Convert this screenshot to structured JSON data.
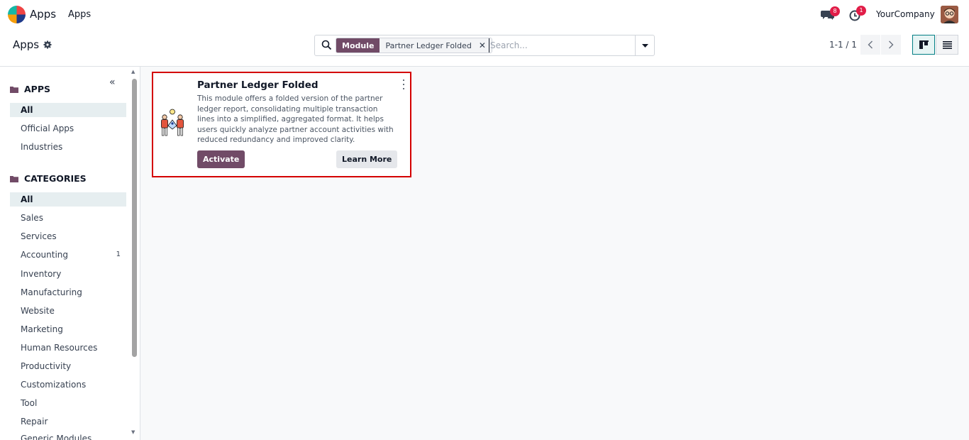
{
  "navbar": {
    "brand": "Apps",
    "menu_item": "Apps",
    "messages_badge": "8",
    "activities_badge": "1",
    "company": "YourCompany"
  },
  "control_panel": {
    "breadcrumb": "Apps",
    "search": {
      "facet_label": "Module",
      "facet_value": "Partner Ledger Folded",
      "placeholder": "Search..."
    },
    "pager": "1-1 / 1"
  },
  "sidebar": {
    "apps_header": "APPS",
    "apps_items": [
      {
        "label": "All",
        "active": true
      },
      {
        "label": "Official Apps"
      },
      {
        "label": "Industries"
      }
    ],
    "categories_header": "CATEGORIES",
    "category_items": [
      {
        "label": "All",
        "active": true
      },
      {
        "label": "Sales"
      },
      {
        "label": "Services"
      },
      {
        "label": "Accounting",
        "count": "1"
      },
      {
        "label": "Inventory"
      },
      {
        "label": "Manufacturing"
      },
      {
        "label": "Website"
      },
      {
        "label": "Marketing"
      },
      {
        "label": "Human Resources"
      },
      {
        "label": "Productivity"
      },
      {
        "label": "Customizations"
      },
      {
        "label": "Tool"
      },
      {
        "label": "Repair"
      },
      {
        "label": "Generic Modules"
      }
    ]
  },
  "card": {
    "title": "Partner Ledger Folded",
    "description": "This module offers a folded version of the partner ledger report, consolidating multiple transaction lines into a simplified, aggregated format. It helps users quickly analyze partner account activities with reduced redundancy and improved clarity.",
    "activate_label": "Activate",
    "learn_more_label": "Learn More"
  },
  "colors": {
    "brand": "#714b67",
    "highlight_border": "#d40000",
    "badge": "#e11d48"
  }
}
